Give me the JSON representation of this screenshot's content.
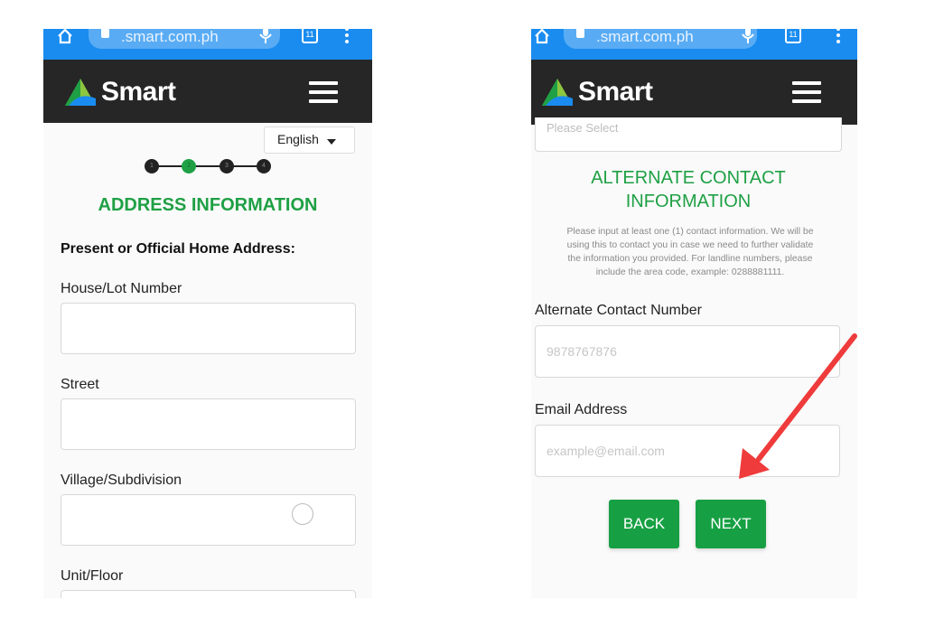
{
  "browser": {
    "url": ".smart.com.ph",
    "tab_count": "11"
  },
  "brand": {
    "name": "Smart",
    "green": "#1fa045",
    "header_bg": "#262626",
    "url_bar_bg": "#1a8cf0"
  },
  "left_screen": {
    "language": "English",
    "steps": [
      "1",
      "2",
      "3",
      "4"
    ],
    "active_step": 2,
    "section_title": "ADDRESS INFORMATION",
    "subheading": "Present or Official Home Address:",
    "fields": [
      {
        "label": "House/Lot Number",
        "value": ""
      },
      {
        "label": "Street",
        "value": ""
      },
      {
        "label": "Village/Subdivision",
        "value": ""
      },
      {
        "label": "Unit/Floor",
        "value": ""
      }
    ]
  },
  "right_screen": {
    "select_placeholder": "Please Select",
    "section_title_line1": "ALTERNATE CONTACT",
    "section_title_line2": "INFORMATION",
    "instructions": [
      "Please input at least one (1) contact information. We will be",
      "using this to contact you in case we need to further validate",
      "the information you provided. For landline numbers, please",
      "include the area code, example: 0288881111."
    ],
    "alternate_contact": {
      "label": "Alternate Contact Number",
      "placeholder": "9878767876"
    },
    "email": {
      "label": "Email Address",
      "placeholder": "example@email.com"
    },
    "back_label": "BACK",
    "next_label": "NEXT"
  },
  "annotation": {
    "arrow_color": "#ef3b3b"
  }
}
